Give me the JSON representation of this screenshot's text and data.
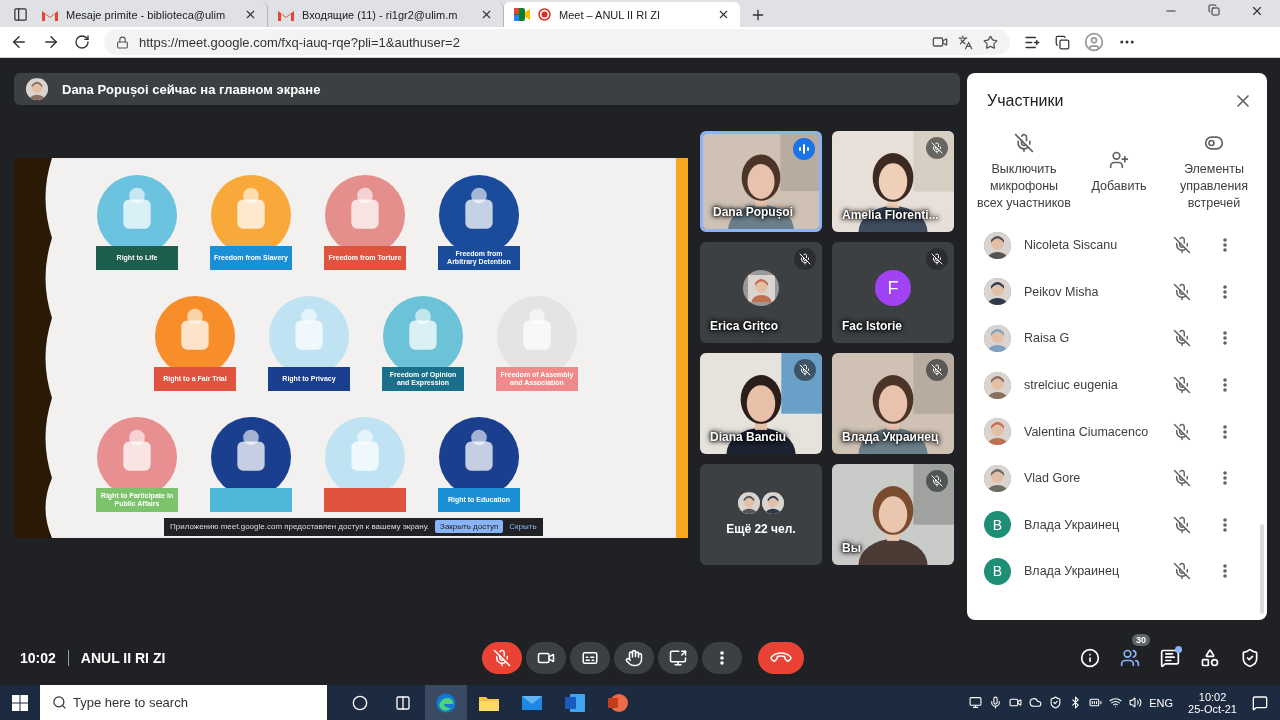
{
  "browser": {
    "tabs": [
      {
        "title": "Mesaje primite - biblioteca@ulim",
        "kind": "gmail",
        "selected": false,
        "recording": false
      },
      {
        "title": "Входящие (11) - ri1gr2@ulim.m",
        "kind": "gmail",
        "selected": false,
        "recording": false
      },
      {
        "title": "Meet – ANUL II RI ZI",
        "kind": "meet",
        "selected": true,
        "recording": true
      }
    ],
    "address": "https://meet.google.com/fxq-iauq-rqe?pli=1&authuser=2"
  },
  "banner": {
    "text": "Dana Popușoi сейчас на главном экране"
  },
  "slide": {
    "rows": [
      [
        {
          "color": "#6cc3df",
          "ribbon": {
            "label": "Right to Life",
            "color": "#1d5e4f"
          }
        },
        {
          "color": "#f9a93a",
          "ribbon": {
            "label": "Freedom from Slavery",
            "color": "#1b8fd6"
          }
        },
        {
          "color": "#e58f8c",
          "ribbon": {
            "label": "Freedom from Torture",
            "color": "#e0533f"
          }
        },
        {
          "color": "#1b4c9c",
          "ribbon": {
            "label": "Freedom from Arbitrary Detention",
            "color": "#1b4c9c"
          }
        }
      ],
      [
        {
          "color": "#f78e2a",
          "ribbon": {
            "label": "Right to a Fair Trial",
            "color": "#e0533f"
          }
        },
        {
          "color": "#bfe3f2",
          "ribbon": {
            "label": "Right to Privacy",
            "color": "#1b3f8f"
          }
        },
        {
          "color": "#6cc3d8",
          "ribbon": {
            "label": "Freedom of Opinion and Expression",
            "color": "#1a6f8a"
          }
        },
        {
          "color": "#e4e4e4",
          "ribbon": {
            "label": "Freedom of Assembly and Association",
            "color": "#f08a8a"
          }
        }
      ],
      [
        {
          "color": "#e89091",
          "ribbon": {
            "label": "Right to Participate in Public Affairs",
            "color": "#7cc36b"
          }
        },
        {
          "color": "#1b3f8f",
          "ribbon": {
            "color": "#4fb8d8"
          }
        },
        {
          "color": "#bfe3f2",
          "ribbon": {
            "color": "#e0533f"
          }
        },
        {
          "color": "#1b3f8f",
          "ribbon": {
            "label": "Right to Education",
            "color": "#1b8fd6"
          }
        }
      ]
    ],
    "share_notice": {
      "text": "Приложению meet.google.com предоставлен доступ к вашему экрану.",
      "button": "Закрыть доступ",
      "link": "Скрыть"
    }
  },
  "tiles": [
    {
      "kind": "video",
      "name": "Dana Popușoi",
      "muted": false,
      "speaking": true
    },
    {
      "kind": "video",
      "name": "Amelia Florenti...",
      "muted": true,
      "speaking": false
    },
    {
      "kind": "avatar",
      "name": "Erica Grițco",
      "muted": true,
      "speaking": false
    },
    {
      "kind": "letter",
      "letter": "F",
      "color": "#a142f4",
      "name": "Fac Istorie",
      "muted": true,
      "speaking": false
    },
    {
      "kind": "video",
      "name": "Diana Banciu",
      "muted": true,
      "speaking": false
    },
    {
      "kind": "video",
      "name": "Влада Украинец",
      "muted": true,
      "speaking": false
    },
    {
      "kind": "more",
      "name": "Ещё 22 чел."
    },
    {
      "kind": "video",
      "name": "Вы",
      "muted": true,
      "speaking": false
    }
  ],
  "panel": {
    "title": "Участники",
    "actions": [
      {
        "kind": "mute_all",
        "label": "Выключить микрофоны всех участников"
      },
      {
        "kind": "add",
        "label": "Добавить"
      },
      {
        "kind": "controls",
        "label": "Элементы управления встречей"
      }
    ],
    "participants": [
      {
        "name": "Nicoleta Siscanu",
        "muted": true
      },
      {
        "name": "Peikov Misha",
        "muted": true
      },
      {
        "name": "Raisa G",
        "muted": true
      },
      {
        "name": "strelciuc eugenia",
        "muted": true
      },
      {
        "name": "Valentina Ciumacenco",
        "muted": true
      },
      {
        "name": "Vlad Gore",
        "muted": true
      },
      {
        "name": "Влада Украинец",
        "kind": "letter",
        "letter": "В",
        "color": "#1e8e76",
        "muted": true
      },
      {
        "name": "Влада Украинец",
        "kind": "letter",
        "letter": "В",
        "color": "#1e8e76",
        "muted": true
      }
    ]
  },
  "bottom_bar": {
    "time": "10:02",
    "meeting": "ANUL II RI ZI",
    "controls": [
      {
        "kind": "mic",
        "muted": true
      },
      {
        "kind": "camera"
      },
      {
        "kind": "captions"
      },
      {
        "kind": "hand"
      },
      {
        "kind": "present"
      },
      {
        "kind": "more"
      },
      {
        "kind": "leave"
      }
    ],
    "side": [
      {
        "kind": "info",
        "selected": false
      },
      {
        "kind": "people",
        "selected": true,
        "badge": "30"
      },
      {
        "kind": "chat",
        "selected": false,
        "unread": true
      },
      {
        "kind": "activities",
        "selected": false
      },
      {
        "kind": "safety",
        "selected": false
      }
    ]
  },
  "taskbar": {
    "search": {
      "placeholder": "Type here to search"
    },
    "apps": [
      {
        "kind": "cortana",
        "selected": false
      },
      {
        "kind": "taskview",
        "selected": false
      },
      {
        "kind": "edge",
        "selected": true
      },
      {
        "kind": "explorer",
        "selected": false
      },
      {
        "kind": "mail",
        "selected": false
      },
      {
        "kind": "word",
        "selected": false
      },
      {
        "kind": "powerpoint",
        "selected": false
      }
    ],
    "language": "ENG",
    "time": "10:02",
    "date": "25-Oct-21"
  }
}
